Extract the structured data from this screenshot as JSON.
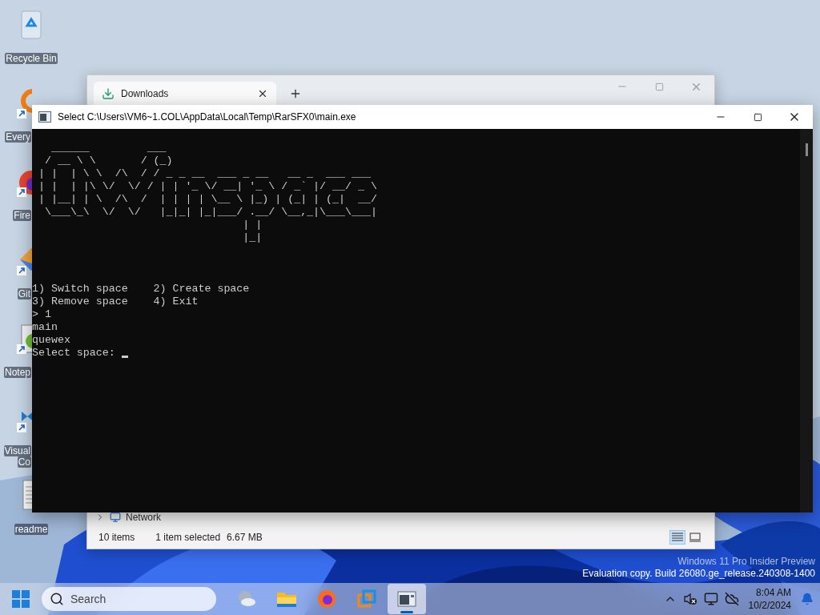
{
  "desktop_icons": [
    {
      "kind": "recycle",
      "lines": [
        "Recycle Bin"
      ],
      "shortcut": false
    },
    {
      "kind": "search",
      "lines": [
        "Every"
      ],
      "shortcut": true
    },
    {
      "kind": "firefox",
      "lines": [
        "Fire"
      ],
      "shortcut": true
    },
    {
      "kind": "git",
      "lines": [
        "Git"
      ],
      "shortcut": true
    },
    {
      "kind": "notepad",
      "lines": [
        "Notep"
      ],
      "shortcut": true
    },
    {
      "kind": "vscode",
      "lines": [
        "Visual",
        "Co"
      ],
      "shortcut": true
    },
    {
      "kind": "document",
      "lines": [
        "readme"
      ],
      "shortcut": false
    }
  ],
  "explorer": {
    "tab": "Downloads",
    "nav_item": "Network",
    "status": {
      "items": "10 items",
      "selected": "1 item selected",
      "size": "6.67 MB"
    },
    "views": [
      {
        "kind": "details",
        "selected": true
      },
      {
        "kind": "tiles",
        "selected": false
      }
    ]
  },
  "console": {
    "title": "Select C:\\Users\\VM6~1.COL\\AppData\\Local\\Temp\\RarSFX0\\main.exe",
    "art": [
      "   ______         ___",
      "  / __ \\ \\       / (_)",
      " | |  | \\ \\  /\\  / / _ _ __  ___ _ __   __ _  ___ ___",
      " | |  | |\\ \\/  \\/ / | | '_ \\/ __| '_ \\ / _` |/ __/ _ \\",
      " | |__| | \\  /\\  /  | | | | \\__ \\ |_) | (_| | (_|  __/",
      "  \\___\\_\\  \\/  \\/   |_|_| |_|___/ .__/ \\__,_|\\___\\___|",
      "                                 | |",
      "                                 |_|"
    ],
    "lines": [
      "1) Switch space    2) Create space",
      "3) Remove space    4) Exit",
      "> 1",
      "main",
      "quewex"
    ],
    "prompt": "Select space: "
  },
  "watermark": [
    "Windows 11 Pro Insider Preview",
    "Evaluation copy. Build 26080.ge_release.240308-1400"
  ],
  "taskbar": {
    "search": {
      "placeholder": "Search"
    },
    "apps": [
      {
        "kind": "weather",
        "selected": false
      },
      {
        "kind": "folder",
        "selected": false
      },
      {
        "kind": "firefox",
        "selected": false
      },
      {
        "kind": "vm",
        "selected": false
      },
      {
        "kind": "console",
        "selected": true
      }
    ],
    "time": "8:04 AM",
    "date": "10/2/2024"
  }
}
